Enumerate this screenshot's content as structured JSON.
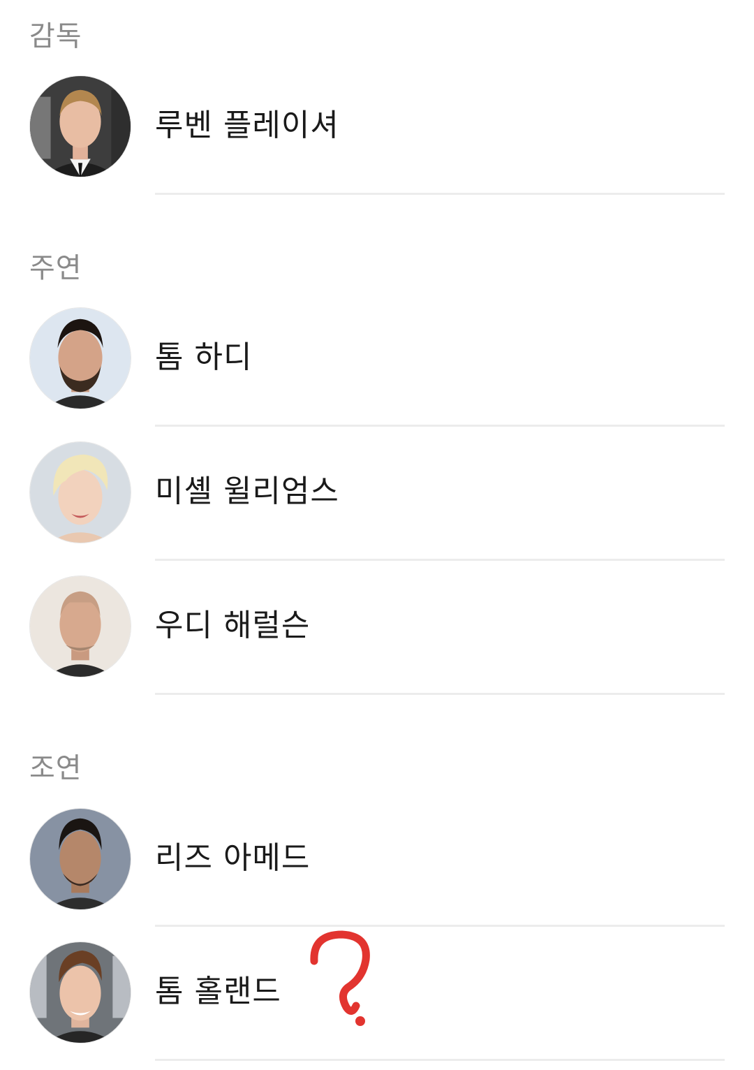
{
  "sections": {
    "director": {
      "label": "감독",
      "people": [
        {
          "name": "루벤 플레이셔"
        }
      ]
    },
    "lead": {
      "label": "주연",
      "people": [
        {
          "name": "톰 하디"
        },
        {
          "name": "미셸 윌리엄스"
        },
        {
          "name": "우디 해럴슨"
        }
      ]
    },
    "supporting": {
      "label": "조연",
      "people": [
        {
          "name": "리즈 아메드"
        },
        {
          "name": "톰 홀랜드"
        }
      ]
    }
  },
  "annotation": {
    "symbol": "?",
    "color": "#e2342f"
  },
  "icons": {
    "avatar": "person-photo-icon",
    "annotation": "question-mark-icon"
  }
}
